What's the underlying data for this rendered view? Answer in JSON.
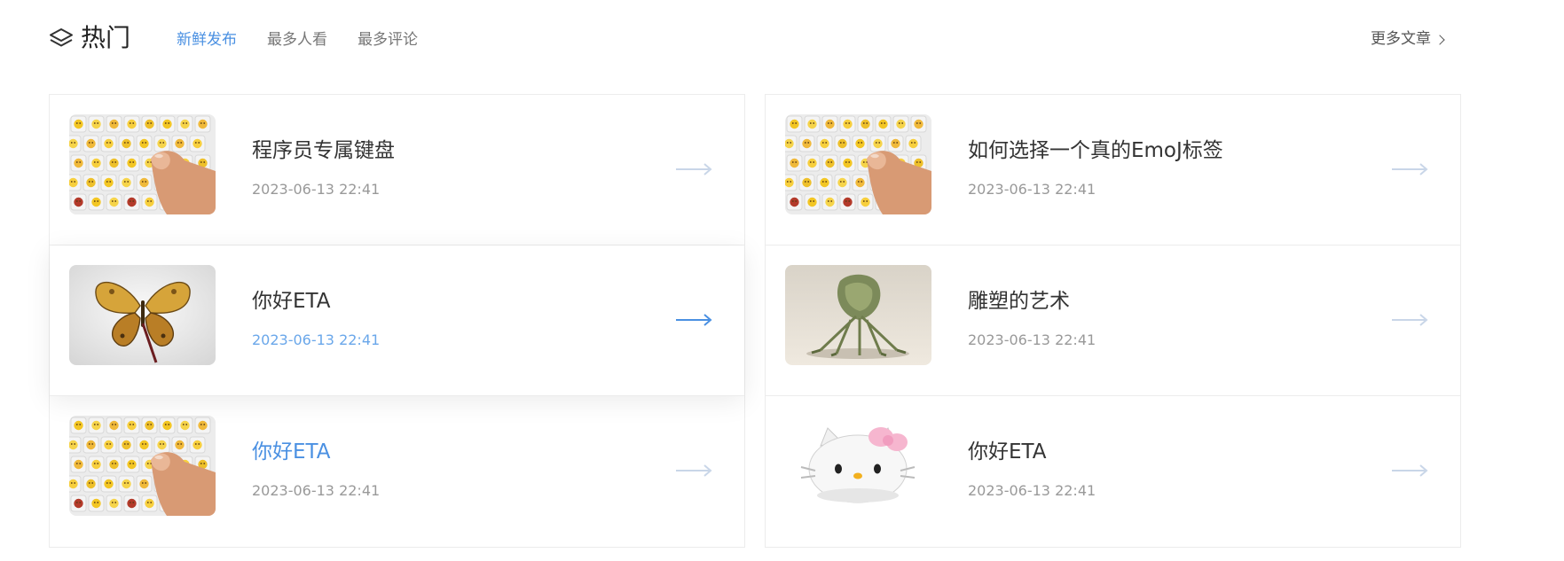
{
  "header": {
    "title": "热门",
    "tabs": [
      {
        "label": "新鲜发布",
        "active": true
      },
      {
        "label": "最多人看",
        "active": false
      },
      {
        "label": "最多评论",
        "active": false
      }
    ],
    "more_label": "更多文章"
  },
  "colors": {
    "accent": "#4a90e2",
    "text": "#333333",
    "muted": "#999999",
    "border": "#ececec",
    "arrow_inactive": "#c9d6e8"
  },
  "articles_left": [
    {
      "title": "程序员专属键盘",
      "date": "2023-06-13 22:41",
      "image": "emoji-keyboard",
      "title_highlight": false,
      "date_highlight": false,
      "arrow_active": false
    },
    {
      "title": "你好ETA",
      "date": "2023-06-13 22:41",
      "image": "butterfly",
      "title_highlight": false,
      "date_highlight": true,
      "arrow_active": true
    },
    {
      "title": "你好ETA",
      "date": "2023-06-13 22:41",
      "image": "emoji-keyboard",
      "title_highlight": true,
      "date_highlight": false,
      "arrow_active": false
    }
  ],
  "articles_right": [
    {
      "title": "如何选择一个真的EmoJ标签",
      "date": "2023-06-13 22:41",
      "image": "emoji-keyboard",
      "title_highlight": false,
      "date_highlight": false,
      "arrow_active": false
    },
    {
      "title": "雕塑的艺术",
      "date": "2023-06-13 22:41",
      "image": "sculpture",
      "title_highlight": false,
      "date_highlight": false,
      "arrow_active": false
    },
    {
      "title": "你好ETA",
      "date": "2023-06-13 22:41",
      "image": "hello-kitty",
      "title_highlight": false,
      "date_highlight": false,
      "arrow_active": false
    }
  ]
}
